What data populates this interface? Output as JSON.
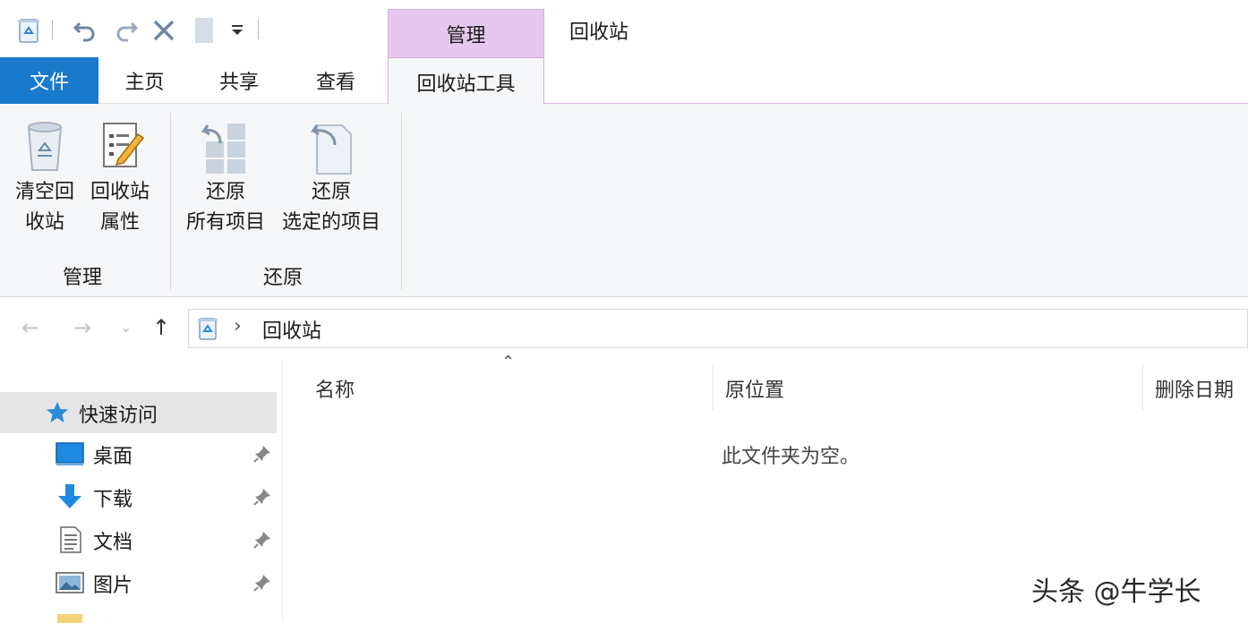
{
  "window": {
    "title": "回收站",
    "context_tab": "管理"
  },
  "tabs": {
    "file": "文件",
    "home": "主页",
    "share": "共享",
    "view": "查看",
    "tools": "回收站工具"
  },
  "ribbon": {
    "empty_bin": {
      "line1": "清空回",
      "line2": "收站"
    },
    "bin_properties": {
      "line1": "回收站",
      "line2": "属性"
    },
    "restore_all": {
      "line1": "还原",
      "line2": "所有项目"
    },
    "restore_selected": {
      "line1": "还原",
      "line2": "选定的项目"
    },
    "groups": {
      "manage": "管理",
      "restore": "还原"
    }
  },
  "address": {
    "chevron": "›",
    "path": "回收站"
  },
  "sidebar": {
    "quick_access": "快速访问",
    "items": [
      {
        "label": "桌面",
        "icon": "desktop-icon"
      },
      {
        "label": "下载",
        "icon": "download-icon"
      },
      {
        "label": "文档",
        "icon": "document-icon"
      },
      {
        "label": "图片",
        "icon": "picture-icon"
      }
    ]
  },
  "content": {
    "columns": [
      "名称",
      "原位置",
      "删除日期"
    ],
    "empty_message": "此文件夹为空。"
  },
  "watermark": "头条 @牛学长",
  "colors": {
    "file_tab": "#1979ca",
    "context_tab": "#e6c8ee",
    "ribbon_bg": "#f5f6f7",
    "selection": "#e5e5e5"
  }
}
